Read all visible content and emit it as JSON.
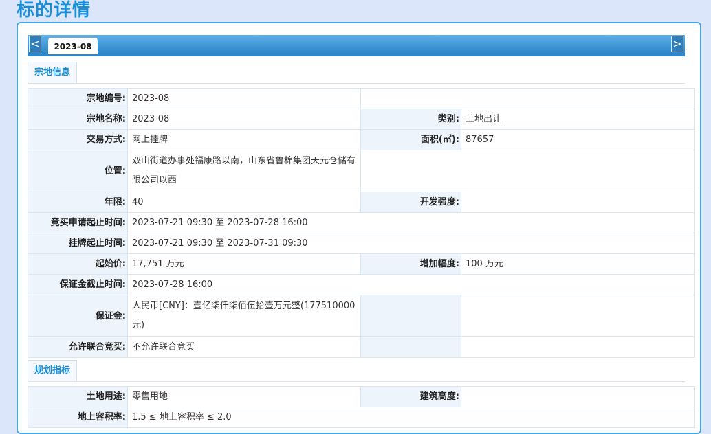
{
  "page_title": "标的详情",
  "tab": {
    "label": "2023-08"
  },
  "nav": {
    "prev": "<",
    "next": ">"
  },
  "section1": {
    "label": "宗地信息",
    "rows": {
      "parcel_no": {
        "label": "宗地编号:",
        "value": "2023-08"
      },
      "parcel_name": {
        "label": "宗地名称:",
        "value": "2023-08"
      },
      "category": {
        "label": "类别:",
        "value": "土地出让"
      },
      "trade_method": {
        "label": "交易方式:",
        "value": "网上挂牌"
      },
      "area": {
        "label": "面积(㎡):",
        "value": "87657"
      },
      "location": {
        "label": "位置:",
        "value": "双山街道办事处福康路以南，山东省鲁棉集团天元仓储有限公司以西"
      },
      "term": {
        "label": "年限:",
        "value": "40"
      },
      "dev_intensity": {
        "label": "开发强度:",
        "value": ""
      },
      "bid_apply_time": {
        "label": "竞买申请起止时间:",
        "value": "2023-07-21 09:30 至 2023-07-28 16:00"
      },
      "listing_time": {
        "label": "挂牌起止时间:",
        "value": "2023-07-21 09:30 至 2023-07-31 09:30"
      },
      "start_price": {
        "label": "起始价:",
        "value": "17,751 万元"
      },
      "increment": {
        "label": "增加幅度:",
        "value": "100 万元"
      },
      "deposit_deadline": {
        "label": "保证金截止时间:",
        "value": "2023-07-28 16:00"
      },
      "deposit": {
        "label": "保证金:",
        "value": "人民币[CNY]：壹亿柒仟柒佰伍拾壹万元整(177510000元)"
      },
      "joint_bid": {
        "label": "允许联合竞买:",
        "value": "不允许联合竞买"
      }
    }
  },
  "section2": {
    "label": "规划指标",
    "rows": {
      "land_use": {
        "label": "土地用途:",
        "value": "零售用地"
      },
      "building_height": {
        "label": "建筑高度:",
        "value": ""
      },
      "plot_ratio": {
        "label": "地上容积率:",
        "value": "1.5 ≤ 地上容积率 ≤ 2.0"
      }
    }
  }
}
